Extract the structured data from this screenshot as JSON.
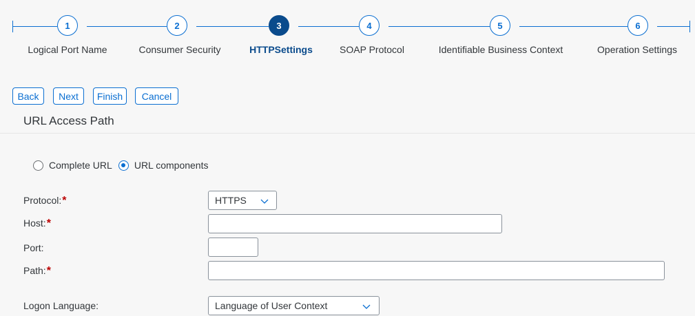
{
  "wizard": {
    "steps": [
      {
        "number": "1",
        "label": "Logical Port Name"
      },
      {
        "number": "2",
        "label": "Consumer Security"
      },
      {
        "number": "3",
        "label": "HTTPSettings",
        "active": true
      },
      {
        "number": "4",
        "label": "SOAP Protocol"
      },
      {
        "number": "5",
        "label": "Identifiable Business Context"
      },
      {
        "number": "6",
        "label": "Operation Settings"
      }
    ]
  },
  "toolbar": {
    "back_label": "Back",
    "next_label": "Next",
    "finish_label": "Finish",
    "cancel_label": "Cancel"
  },
  "section": {
    "title": "URL Access Path"
  },
  "url_mode": {
    "options": [
      {
        "label": "Complete URL",
        "selected": false
      },
      {
        "label": "URL components",
        "selected": true
      }
    ]
  },
  "form": {
    "required_marker": "*",
    "protocol": {
      "label": "Protocol:",
      "value": "HTTPS",
      "required": true
    },
    "host": {
      "label": "Host:",
      "value": "",
      "required": true
    },
    "port": {
      "label": "Port:",
      "value": ""
    },
    "path": {
      "label": "Path:",
      "value": "",
      "required": true
    },
    "logon_language": {
      "label": "Logon Language:",
      "value": "Language of User Context"
    }
  },
  "icons": {
    "chevron": "chevron-down-icon"
  },
  "colors": {
    "accent": "#0a6ed1",
    "active_step": "#0a4b8c",
    "required": "#bb0000"
  }
}
